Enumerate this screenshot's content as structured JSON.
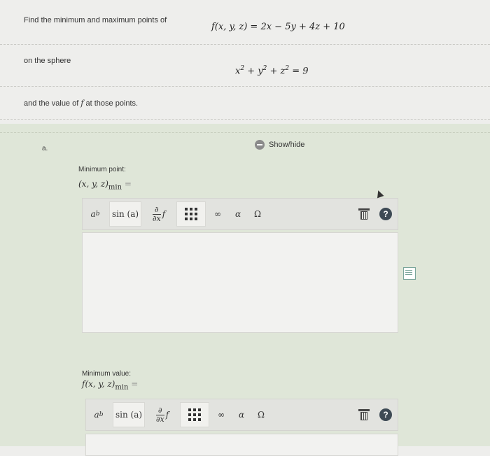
{
  "question": {
    "intro": "Find the minimum and maximum points of",
    "function": "f(x, y, z) = 2x − 5y + 4z + 10",
    "constraint_label": "on the sphere",
    "constraint": {
      "base": "x",
      "b2": "+ y",
      "b3": "+ z",
      "exp": "2",
      "rhs": "= 9"
    },
    "tail_prefix": "and the value of",
    "tail_var": "f",
    "tail_suffix": "at those points."
  },
  "part": {
    "label": "a.",
    "toggle_label": "Show/hide",
    "fields": [
      {
        "label": "Minimum point:",
        "expr": "(x, y, z)",
        "sub": "min",
        "eq": "="
      },
      {
        "label": "Minimum value:",
        "expr": "f(x, y, z)",
        "sub": "min",
        "eq": "="
      }
    ]
  },
  "toolbar": {
    "power": {
      "base": "a",
      "exp": "b"
    },
    "sin": "sin (a)",
    "partial_top": "∂",
    "partial_bottom": "∂x",
    "partial_f": "f",
    "infinity": "∞",
    "alpha": "α",
    "omega": "Ω",
    "help": "?"
  },
  "icons": [
    "matrix-icon",
    "trash-icon",
    "help-icon",
    "toggle-icon",
    "notes-icon",
    "cursor-icon"
  ]
}
